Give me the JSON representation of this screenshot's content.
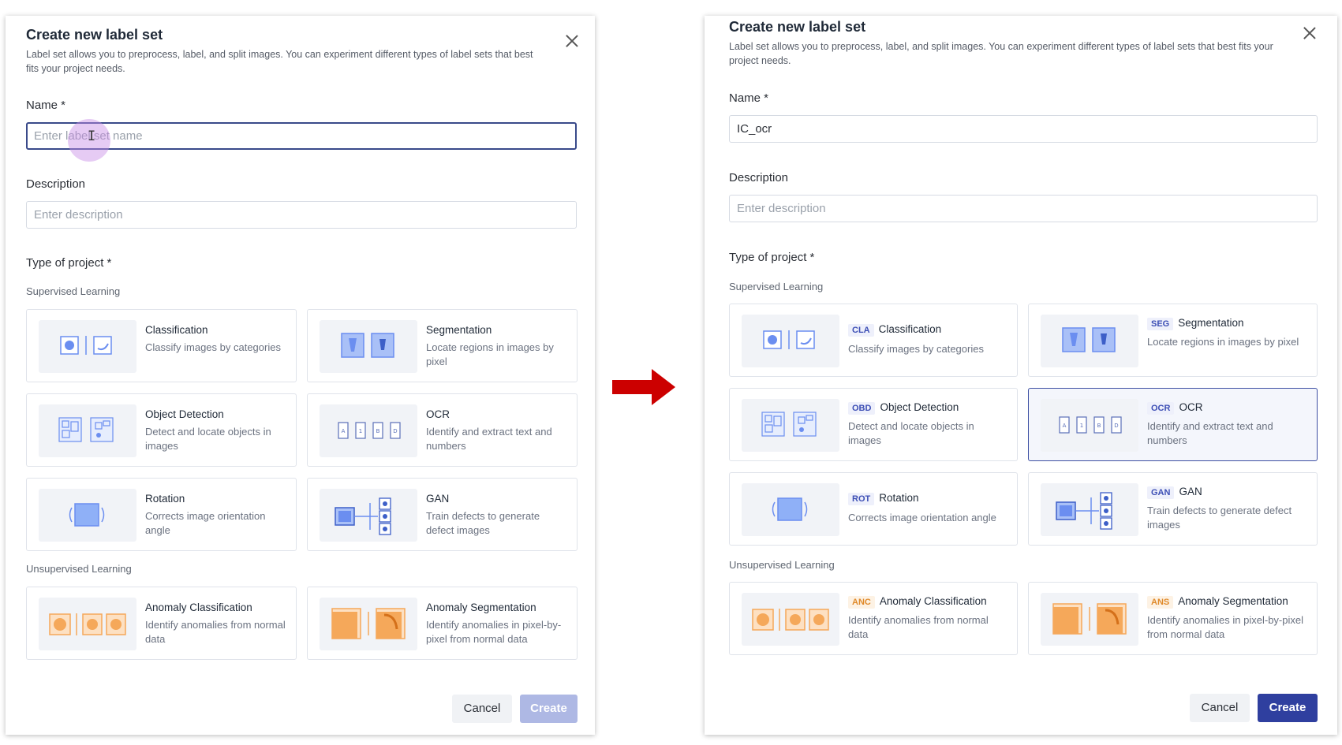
{
  "before": {
    "title": "Create new label set",
    "subtitle": "Label set allows you to preprocess, label, and split images. You can experiment different types of label sets that best fits your project needs.",
    "name_label": "Name *",
    "name_placeholder": "Enter label set name",
    "name_value": "",
    "description_label": "Description",
    "description_placeholder": "Enter description",
    "type_label": "Type of project *",
    "supervised_label": "Supervised Learning",
    "unsupervised_label": "Unsupervised Learning",
    "cards": {
      "classification": {
        "title": "Classification",
        "desc": "Classify images by categories"
      },
      "segmentation": {
        "title": "Segmentation",
        "desc": "Locate regions in images by pixel"
      },
      "object_detection": {
        "title": "Object Detection",
        "desc": "Detect and locate objects in images"
      },
      "ocr": {
        "title": "OCR",
        "desc": "Identify and extract text and numbers"
      },
      "rotation": {
        "title": "Rotation",
        "desc": "Corrects image orientation angle"
      },
      "gan": {
        "title": "GAN",
        "desc": "Train defects to generate defect images"
      },
      "anomaly_classification": {
        "title": "Anomaly Classification",
        "desc": "Identify anomalies from normal data"
      },
      "anomaly_segmentation": {
        "title": "Anomaly Segmentation",
        "desc": "Identify anomalies in pixel-by-pixel from normal data"
      }
    },
    "cancel_label": "Cancel",
    "create_label": "Create"
  },
  "after": {
    "title": "Create new label set",
    "subtitle": "Label set allows you to preprocess, label, and split images. You can experiment different types of label sets that best fits your project needs.",
    "name_label": "Name *",
    "name_value": "IC_ocr",
    "description_label": "Description",
    "description_placeholder": "Enter description",
    "type_label": "Type of project *",
    "supervised_label": "Supervised Learning",
    "unsupervised_label": "Unsupervised Learning",
    "cards": {
      "classification": {
        "badge": "CLA",
        "title": "Classification",
        "desc": "Classify images by categories"
      },
      "segmentation": {
        "badge": "SEG",
        "title": "Segmentation",
        "desc": "Locate regions in images by pixel"
      },
      "object_detection": {
        "badge": "OBD",
        "title": "Object Detection",
        "desc": "Detect and locate objects in images"
      },
      "ocr": {
        "badge": "OCR",
        "title": "OCR",
        "desc": "Identify and extract text and numbers"
      },
      "rotation": {
        "badge": "ROT",
        "title": "Rotation",
        "desc": "Corrects image orientation angle"
      },
      "gan": {
        "badge": "GAN",
        "title": "GAN",
        "desc": "Train defects to generate defect images"
      },
      "anomaly_classification": {
        "badge": "ANC",
        "title": "Anomaly Classification",
        "desc": "Identify anomalies from normal data"
      },
      "anomaly_segmentation": {
        "badge": "ANS",
        "title": "Anomaly Segmentation",
        "desc": "Identify anomalies in pixel-by-pixel from normal data"
      }
    },
    "selected_card": "OCR",
    "cancel_label": "Cancel",
    "create_label": "Create"
  },
  "colors": {
    "primary": "#2f3f9f",
    "primary_disabled": "#aeb8e4",
    "selected_border": "#3d4fa3",
    "badge_blue": "#3d4fb5",
    "badge_orange": "#e08a2a",
    "arrow": "#cc0000",
    "icon_blue": "#6b8ef0",
    "icon_orange": "#f5a85a"
  },
  "icons": {
    "transition": "arrow-right-icon",
    "close": "close-icon"
  }
}
